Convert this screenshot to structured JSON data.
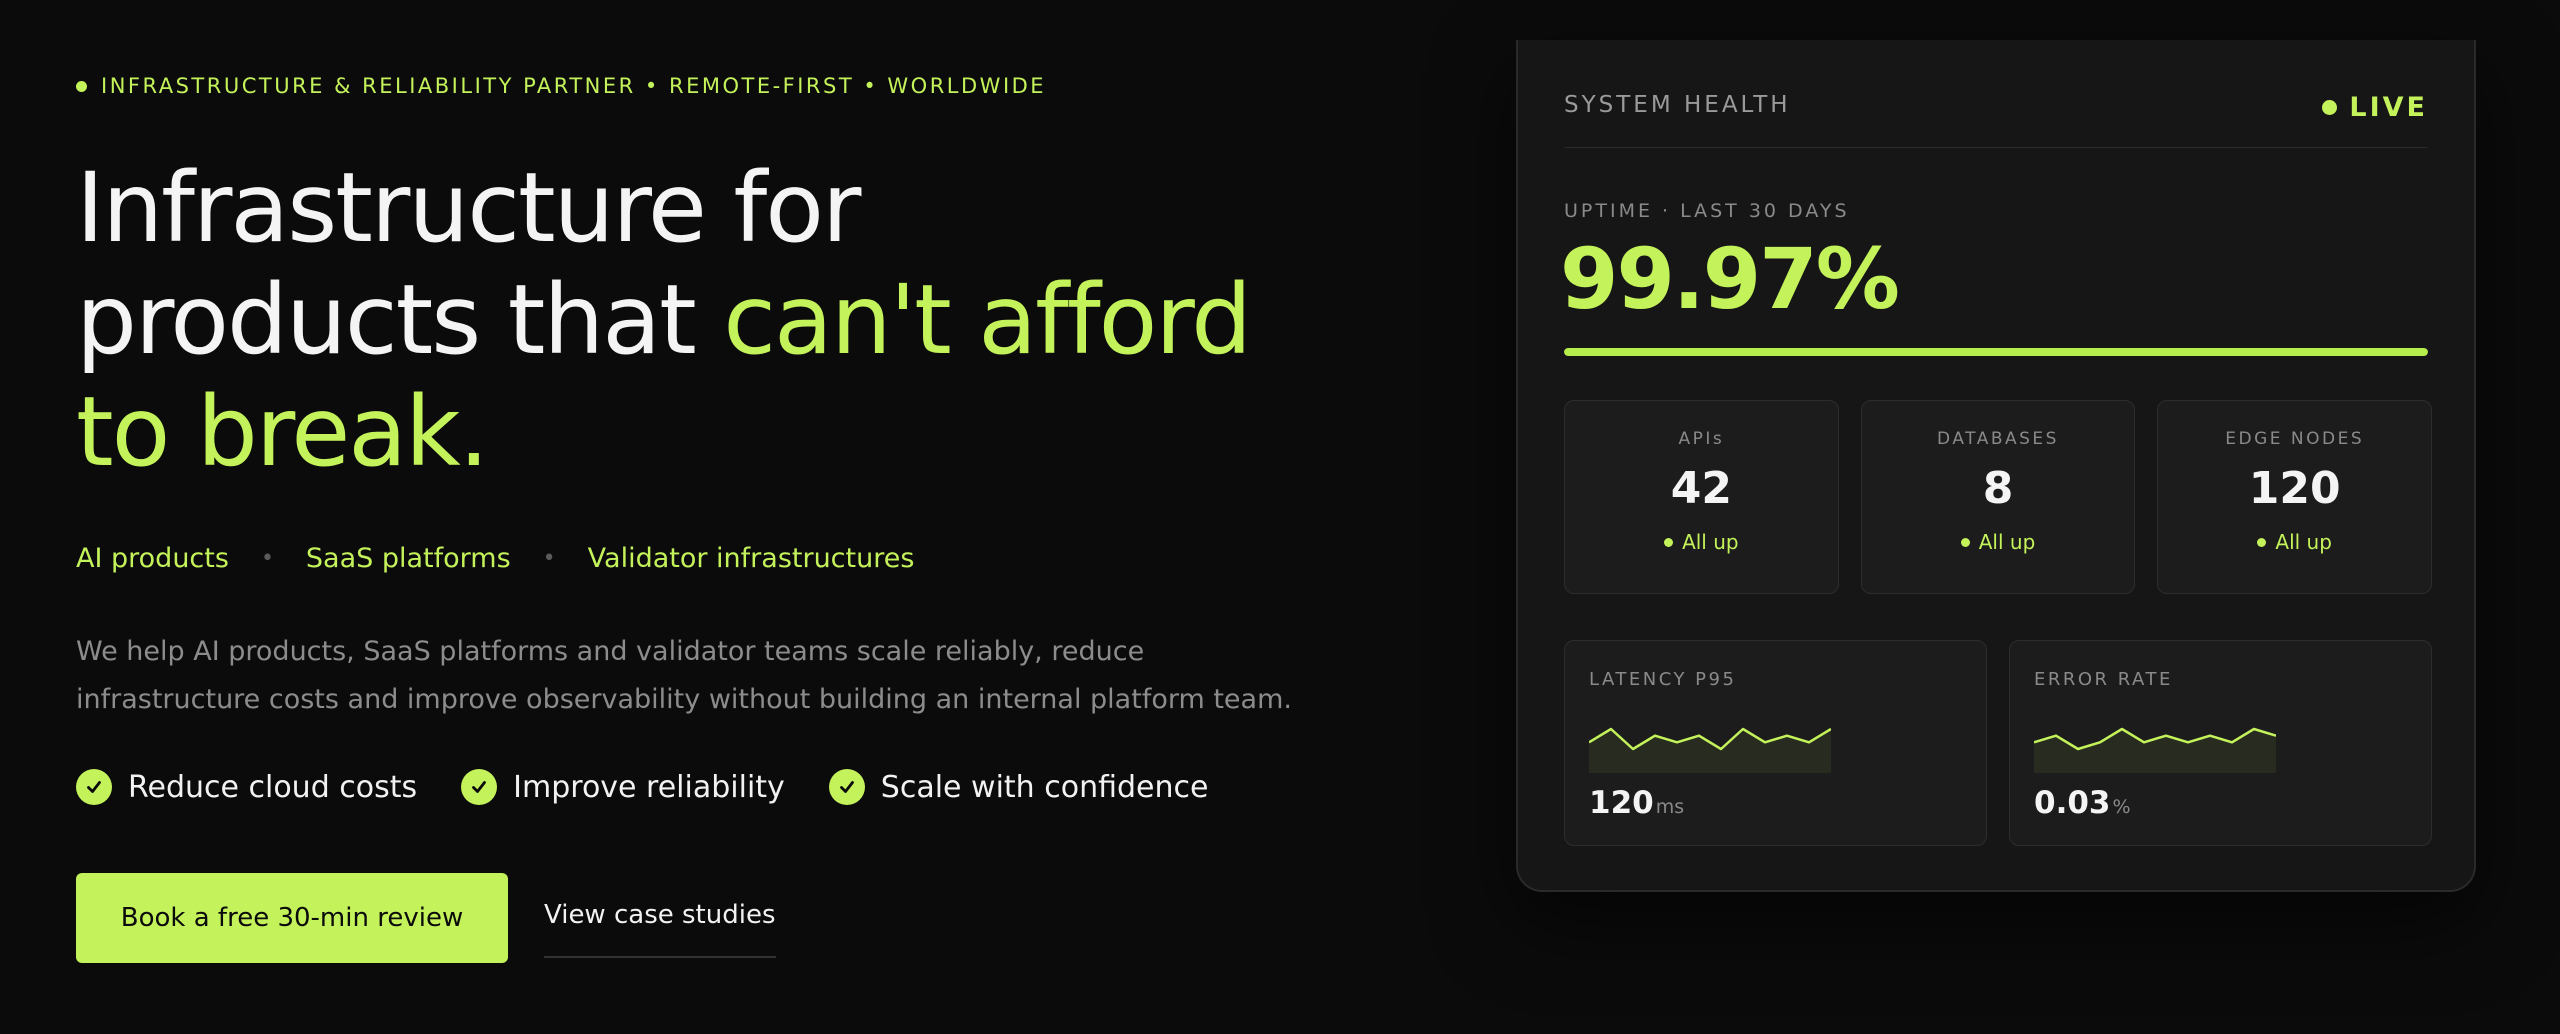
{
  "eyebrow": "INFRASTRUCTURE & RELIABILITY PARTNER • REMOTE-FIRST • WORLDWIDE",
  "headline": {
    "line1": "Infrastructure for",
    "line2_plain": "products that ",
    "line2_accent": "can't afford",
    "line3_accent": "to break."
  },
  "tags": [
    "AI products",
    "SaaS platforms",
    "Validator infrastructures"
  ],
  "tag_separator": "•",
  "description": "We help AI products, SaaS platforms and validator teams scale reliably, reduce infrastructure costs and improve observability without building an internal platform team.",
  "benefits": [
    "Reduce cloud costs",
    "Improve reliability",
    "Scale with confidence"
  ],
  "cta": {
    "primary": "Book a free 30-min review",
    "secondary": "View case studies"
  },
  "colors": {
    "accent": "#c4f25a",
    "background": "#0b0b0b",
    "card": "#161616"
  },
  "icons": {
    "benefit": "check-circle-icon",
    "status": "status-dot-icon"
  },
  "health": {
    "title": "SYSTEM HEALTH",
    "live_label": "LIVE",
    "uptime_label": "UPTIME · LAST 30 DAYS",
    "uptime_value": "99.97%",
    "uptime_fraction": 0.9997,
    "stats": [
      {
        "label": "APIs",
        "value": "42",
        "status": "All up"
      },
      {
        "label": "DATABASES",
        "value": "8",
        "status": "All up"
      },
      {
        "label": "EDGE NODES",
        "value": "120",
        "status": "All up"
      }
    ],
    "metrics": [
      {
        "label": "LATENCY P95",
        "value": "120",
        "unit": "ms",
        "trend": [
          5,
          7,
          4,
          6,
          5,
          6,
          4,
          7,
          5,
          6,
          5,
          7
        ]
      },
      {
        "label": "ERROR RATE",
        "value": "0.03",
        "unit": "%",
        "trend": [
          3,
          4,
          2,
          3,
          5,
          3,
          4,
          3,
          4,
          3,
          5,
          4
        ]
      }
    ]
  }
}
